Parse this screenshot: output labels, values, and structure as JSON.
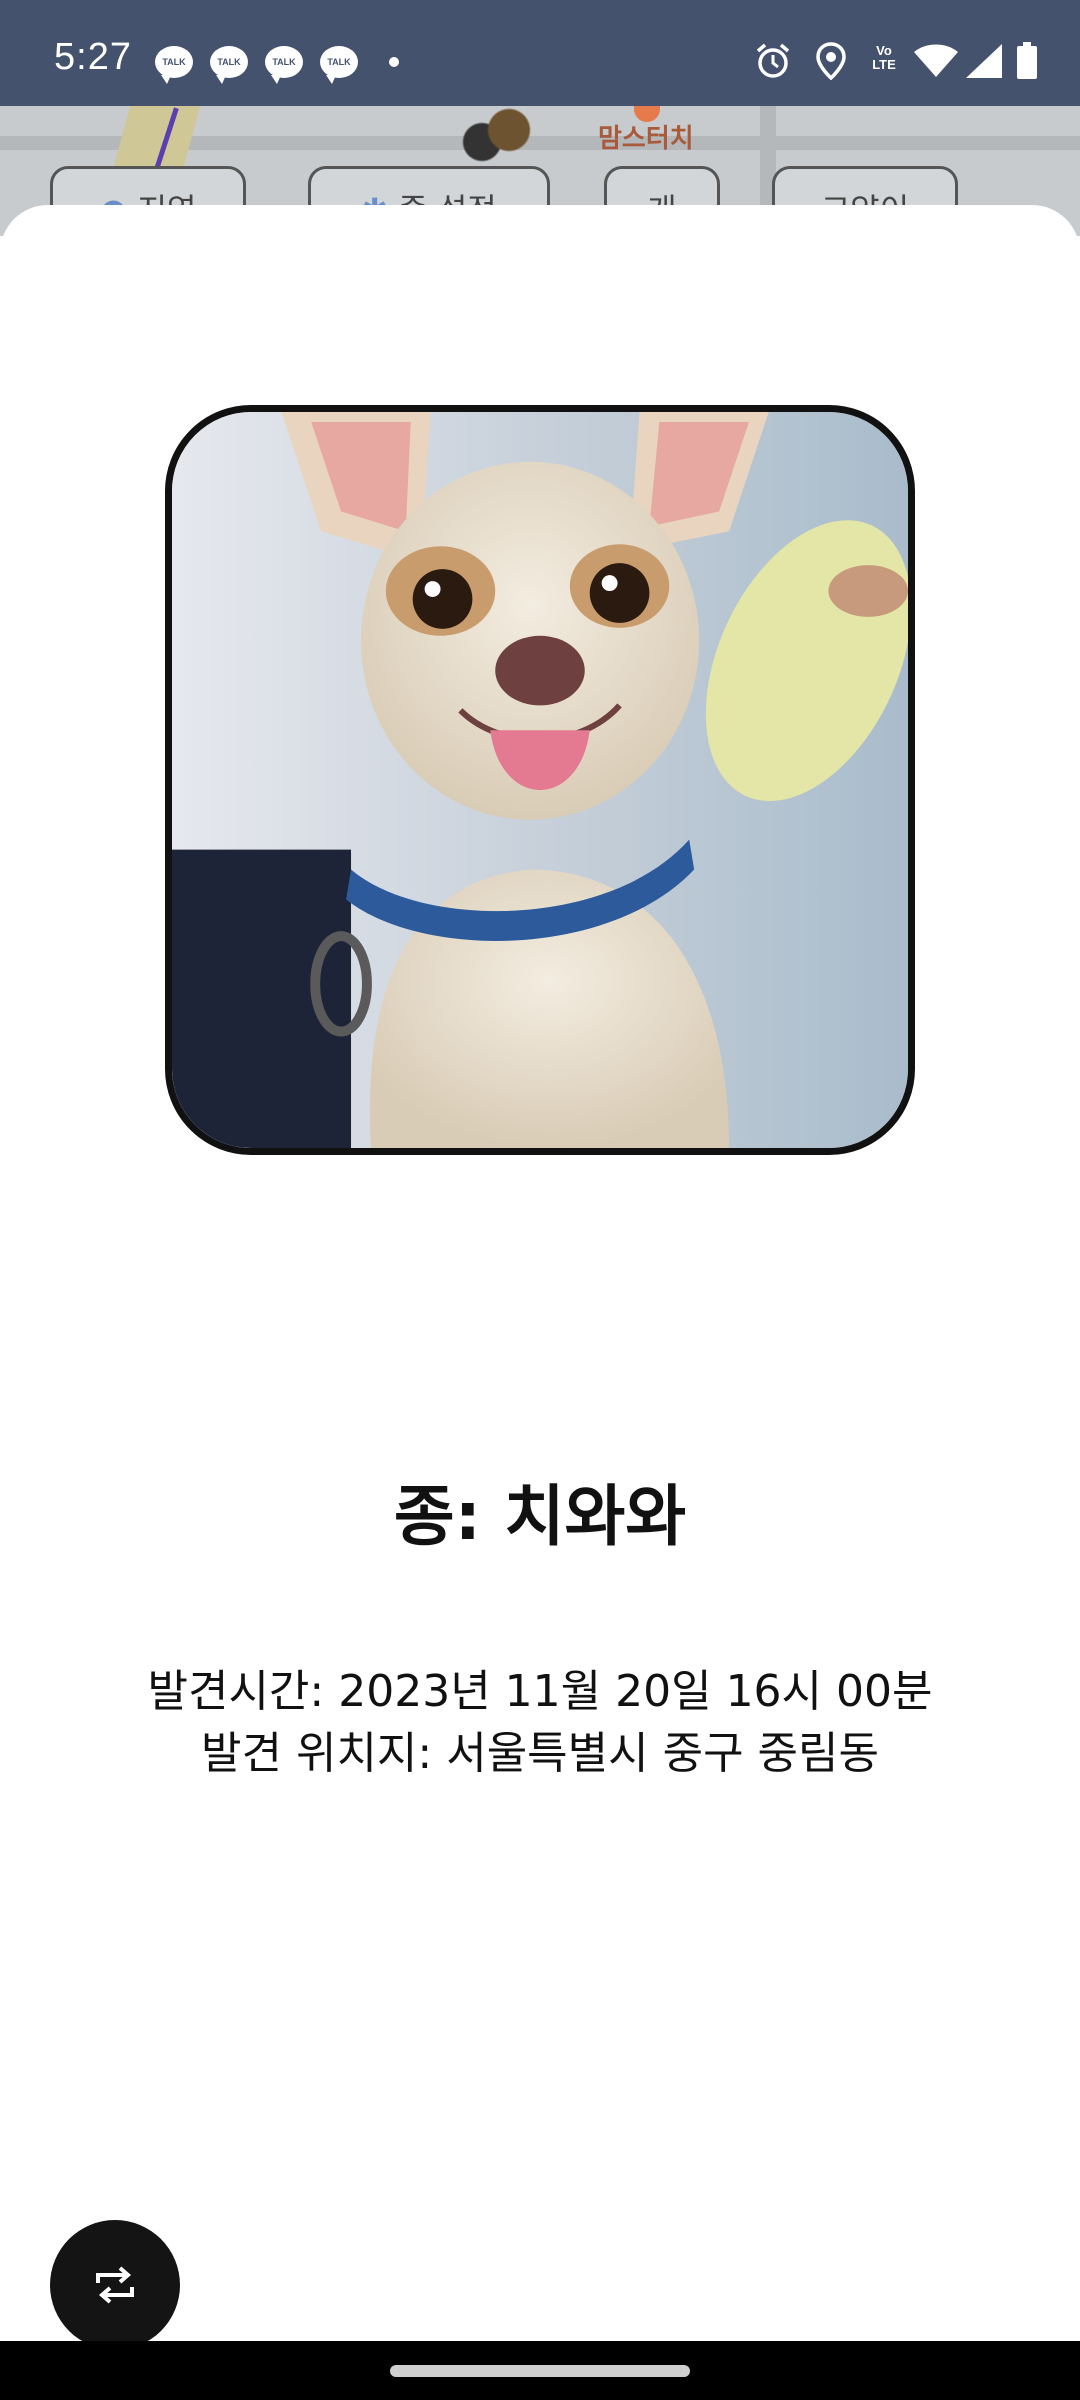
{
  "status_bar": {
    "time": "5:27",
    "notifications": [
      "TALK",
      "TALK",
      "TALK",
      "TALK"
    ],
    "icons": [
      "alarm-icon",
      "location-icon",
      "volte-icon",
      "wifi-icon",
      "signal-icon",
      "battery-icon"
    ],
    "volte_label_top": "Vo",
    "volte_label_bottom": "LTE"
  },
  "map_background": {
    "place_label": "맘스터치",
    "filter_chips": [
      {
        "label": "지역",
        "icon": "location-pin-icon"
      },
      {
        "label": "종 설정",
        "icon": "gear-icon"
      },
      {
        "label": "개"
      },
      {
        "label": "고양이"
      }
    ]
  },
  "detail": {
    "photo_alt": "치와와 사진",
    "species_label": "종: 치와와",
    "found_time": "발견시간: 2023년 11월 20일 16시 00분",
    "found_location": "발견 위치지: 서울특별시 중구 중림동"
  },
  "fab": {
    "icon": "repeat-icon"
  },
  "colors": {
    "status_bar": "#44526d",
    "text": "#111111",
    "fab": "#141414",
    "photo_border": "#111111"
  }
}
